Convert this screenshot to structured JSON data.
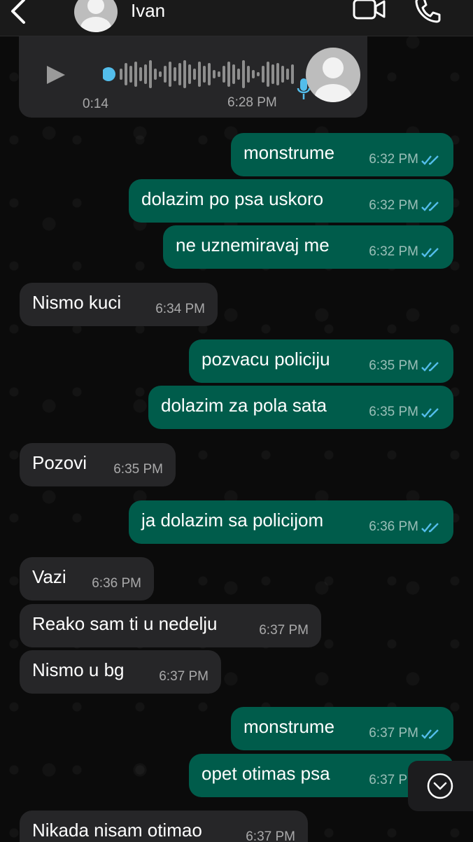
{
  "header": {
    "contact_name": "Ivan",
    "icons": [
      "back-chevron-icon",
      "avatar-icon",
      "video-call-icon",
      "phone-call-icon"
    ]
  },
  "voice_message": {
    "duration": "0:14",
    "time": "6:28 PM"
  },
  "messages": [
    {
      "dir": "out",
      "text": "monstrume",
      "time": "6:32 PM"
    },
    {
      "dir": "out",
      "text": "dolazim po psa uskoro",
      "time": "6:32 PM"
    },
    {
      "dir": "out",
      "text": "ne uznemiravaj me",
      "time": "6:32 PM"
    },
    {
      "dir": "in",
      "text": "Nismo kuci",
      "time": "6:34 PM"
    },
    {
      "dir": "out",
      "text": "pozvacu policiju",
      "time": "6:35 PM"
    },
    {
      "dir": "out",
      "text": "dolazim za pola sata",
      "time": "6:35 PM"
    },
    {
      "dir": "in",
      "text": "Pozovi",
      "time": "6:35 PM"
    },
    {
      "dir": "out",
      "text": "ja dolazim sa policijom",
      "time": "6:36 PM"
    },
    {
      "dir": "in",
      "text": "Vazi",
      "time": "6:36 PM"
    },
    {
      "dir": "in",
      "text": "Reako sam ti u nedelju",
      "time": "6:37 PM"
    },
    {
      "dir": "in",
      "text": "Nismo u bg",
      "time": "6:37 PM"
    },
    {
      "dir": "out",
      "text": "monstrume",
      "time": "6:37 PM"
    },
    {
      "dir": "out",
      "text": "opet otimas psa",
      "time": "6:37 PM"
    },
    {
      "dir": "in",
      "text": "Nikada nisam otimao",
      "time": "6:37 PM"
    }
  ],
  "colors": {
    "outgoing_bubble": "#005c4b",
    "incoming_bubble": "#262628",
    "read_ticks": "#53bdeb",
    "background": "#0b0b0b"
  }
}
